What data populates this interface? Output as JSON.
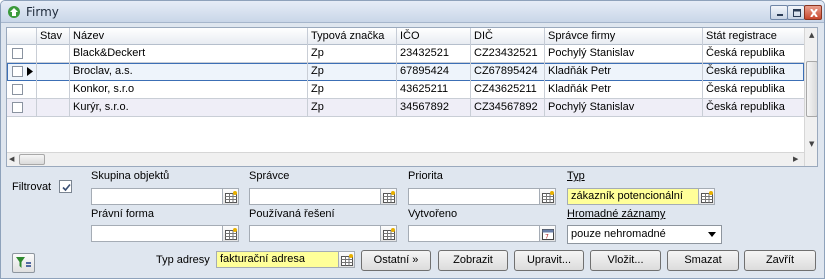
{
  "window": {
    "title": "Firmy",
    "controls": {
      "minimize": "minimize-icon",
      "maximize": "maximize-icon",
      "close": "close-icon"
    }
  },
  "grid": {
    "columns": [
      "",
      "Stav",
      "Název",
      "Typová značka",
      "IČO",
      "DIČ",
      "Správce firmy",
      "Stát registrace"
    ],
    "rows": [
      {
        "name": "Black&Deckert",
        "type": "Zp",
        "ico": "23432521",
        "dic": "CZ23432521",
        "manager": "Pochylý Stanislav",
        "country": "Česká republika"
      },
      {
        "name": "Broclav, a.s.",
        "type": "Zp",
        "ico": "67895424",
        "dic": "CZ67895424",
        "manager": "Kladňák Petr",
        "country": "Česká republika"
      },
      {
        "name": "Konkor, s.r.o",
        "type": "Zp",
        "ico": "43625211",
        "dic": "CZ43625211",
        "manager": "Kladňák Petr",
        "country": "Česká republika"
      },
      {
        "name": "Kurýr, s.r.o.",
        "type": "Zp",
        "ico": "34567892",
        "dic": "CZ34567892",
        "manager": "Pochylý Stanislav",
        "country": "Česká republika"
      }
    ]
  },
  "filter": {
    "label": "Filtrovat",
    "checked": true,
    "fields": {
      "skupina": {
        "label": "Skupina objektů",
        "value": ""
      },
      "spravce": {
        "label": "Správce",
        "value": ""
      },
      "priorita": {
        "label": "Priorita",
        "value": ""
      },
      "typ": {
        "label": "Typ",
        "value": "zákazník potencionální"
      },
      "pravni": {
        "label": "Právní forma",
        "value": ""
      },
      "reseni": {
        "label": "Používaná řešení",
        "value": ""
      },
      "vytvoreno": {
        "label": "Vytvořeno",
        "value": ""
      },
      "hromadne": {
        "label": "Hromadné záznamy",
        "value": "pouze nehromadné"
      },
      "adresa": {
        "label": "Typ adresy",
        "value": "fakturační adresa"
      }
    }
  },
  "buttons": {
    "ostatni": "Ostatní »",
    "zobrazit": "Zobrazit",
    "upravit": "Upravit...",
    "vlozit": "Vložit...",
    "smazat": "Smazat",
    "zavrit": "Zavřít"
  },
  "colors": {
    "highlight_field": "#ffff99",
    "selection_outline": "#3c6fb5"
  }
}
